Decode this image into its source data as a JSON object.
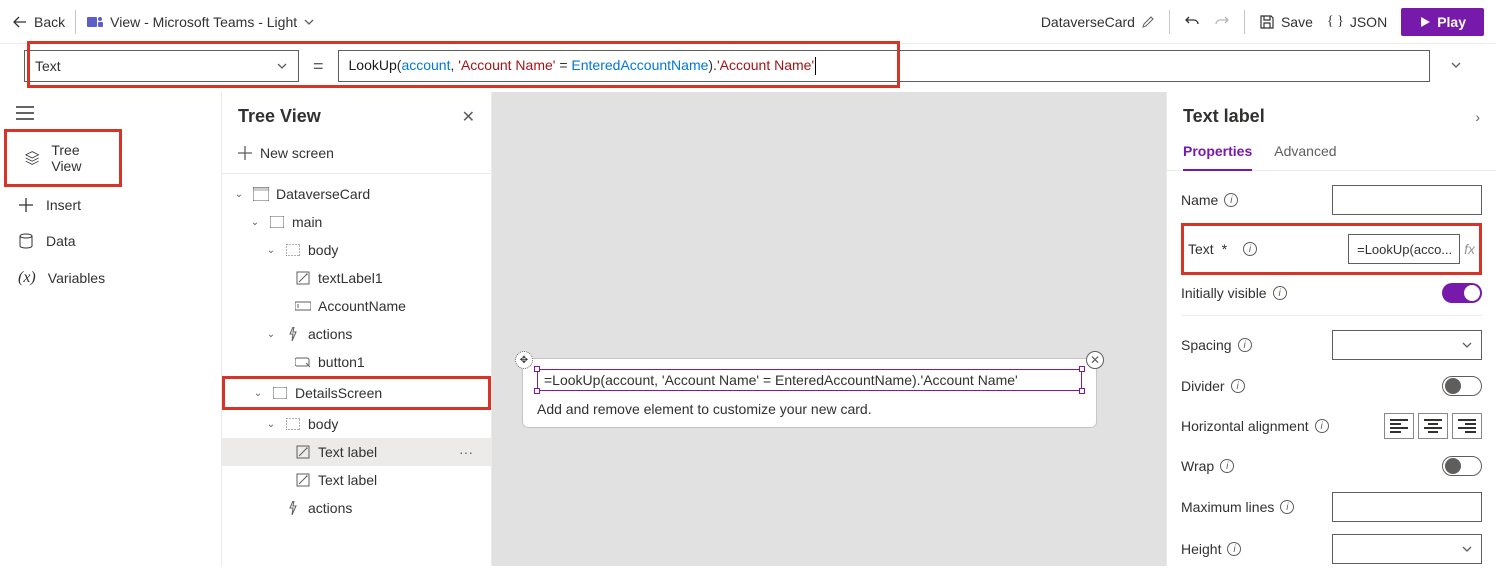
{
  "topbar": {
    "back_label": "Back",
    "view_label": "View - Microsoft Teams - Light",
    "card_name": "DataverseCard",
    "save_label": "Save",
    "json_label": "JSON",
    "play_label": "Play"
  },
  "formulabar": {
    "property_selected": "Text",
    "formula_parts": {
      "p1": "LookUp",
      "p2": "(",
      "p3": "account",
      "p4": ", ",
      "p5": "'Account Name'",
      "p6": " = ",
      "p7": "EnteredAccountName",
      "p8": ").",
      "p9": "'Account Name'"
    }
  },
  "rail": {
    "items": [
      {
        "label": "Tree View",
        "icon": "layers-icon",
        "active": true
      },
      {
        "label": "Insert",
        "icon": "plus-icon"
      },
      {
        "label": "Data",
        "icon": "data-icon"
      },
      {
        "label": "Variables",
        "icon": "variables-icon"
      }
    ]
  },
  "tree": {
    "title": "Tree View",
    "new_screen_label": "New screen",
    "nodes": {
      "n0": "DataverseCard",
      "n1": "main",
      "n2": "body",
      "n3": "textLabel1",
      "n4": "AccountName",
      "n5": "actions",
      "n6": "button1",
      "n7": "DetailsScreen",
      "n8": "body",
      "n9": "Text label",
      "n10": "Text label",
      "n11": "actions"
    }
  },
  "canvas": {
    "fx_text": "=LookUp(account, 'Account Name' = EnteredAccountName).'Account Name'",
    "hint": "Add and remove element to customize your new card."
  },
  "props": {
    "title": "Text label",
    "tabs": {
      "properties": "Properties",
      "advanced": "Advanced"
    },
    "rows": {
      "name": "Name",
      "text": "Text",
      "text_required": "*",
      "text_value": "=LookUp(acco...",
      "initially_visible": "Initially visible",
      "spacing": "Spacing",
      "divider": "Divider",
      "horizontal_alignment": "Horizontal alignment",
      "wrap": "Wrap",
      "maximum_lines": "Maximum lines",
      "height": "Height"
    }
  }
}
